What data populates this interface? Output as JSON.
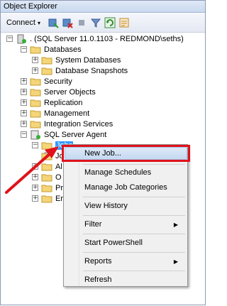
{
  "window": {
    "title": "Object Explorer"
  },
  "toolbar": {
    "connect_label": "Connect",
    "connect_arrow": "▾",
    "icons": [
      "connect-icon",
      "disconnect-icon",
      "stop-icon",
      "filter-icon",
      "refresh-icon",
      "properties-icon"
    ]
  },
  "tree": {
    "server": ". (SQL Server 11.0.1103 - REDMOND\\seths)",
    "databases": "Databases",
    "system_databases": "System Databases",
    "database_snapshots": "Database Snapshots",
    "security": "Security",
    "server_objects": "Server Objects",
    "replication": "Replication",
    "management": "Management",
    "integration_services": "Integration Services",
    "sql_server_agent": "SQL Server Agent",
    "jobs": "Jobs",
    "partial_1": "Jo",
    "partial_2": "Al",
    "partial_3": "O",
    "partial_4": "Pr",
    "partial_5": "Er"
  },
  "context_menu": {
    "new_job": "New Job...",
    "manage_schedules": "Manage Schedules",
    "manage_job_categories": "Manage Job Categories",
    "view_history": "View History",
    "filter": "Filter",
    "start_powershell": "Start PowerShell",
    "reports": "Reports",
    "refresh": "Refresh",
    "submenu_arrow": "▶"
  },
  "colors": {
    "highlight_box": "#e0121a",
    "arrow": "#e0121a",
    "selection": "#3399ff"
  }
}
